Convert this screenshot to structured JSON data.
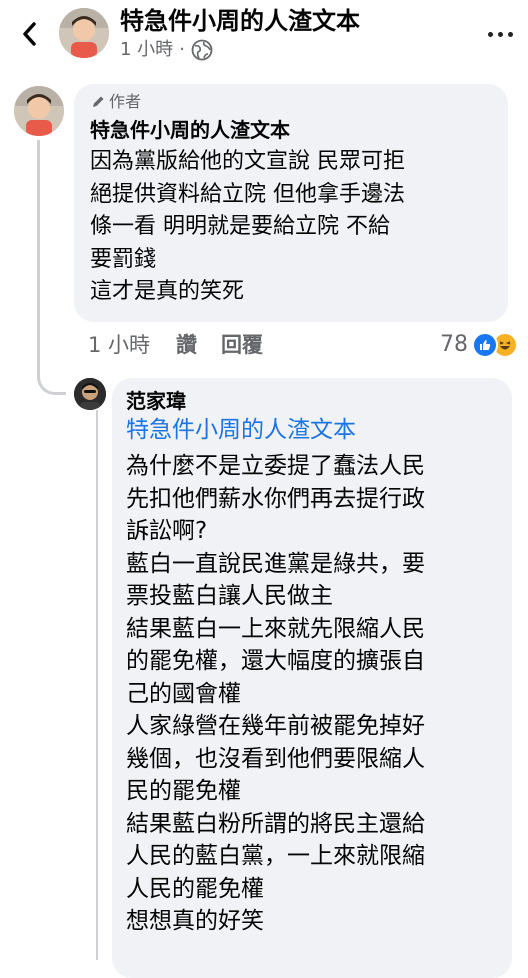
{
  "header": {
    "back_icon": "chevron-left-icon",
    "title": "特急件小周的人渣文本",
    "time": "1 小時",
    "separator": "·",
    "privacy_icon": "globe-icon",
    "more_icon": "more-horizontal-icon"
  },
  "comment1": {
    "badge": "作者",
    "badge_icon": "pencil-icon",
    "author": "特急件小周的人渣文本",
    "lines": [
      "因為黨版給他的文宣說 民眾可拒",
      "絕提供資料給立院 但他拿手邊法",
      "條一看 明明就是要給立院 不給",
      "要罰錢",
      "這才是真的笑死"
    ],
    "time": "1 小時",
    "like_label": "讚",
    "reply_label": "回覆",
    "reaction_count": "78",
    "reactions": [
      "like-icon",
      "haha-icon"
    ]
  },
  "comment2": {
    "author": "范家瑋",
    "mention": "特急件小周的人渣文本",
    "lines": [
      "為什麼不是立委提了蠢法人民",
      "先扣他們薪水你們再去提行政",
      "訴訟啊?",
      "藍白一直說民進黨是綠共，要",
      "票投藍白讓人民做主",
      "結果藍白一上來就先限縮人民",
      "的罷免權，還大幅度的擴張自",
      "己的國會權",
      "人家綠營在幾年前被罷免掉好",
      "幾個，也沒看到他們要限縮人",
      "民的罷免權",
      "結果藍白粉所謂的將民主還給",
      "人民的藍白黨，一上來就限縮",
      "人民的罷免權",
      "想想真的好笑"
    ]
  },
  "colors": {
    "bubble": "#f0f2f5",
    "secondary_text": "#65676b",
    "link": "#1b74e4",
    "like": "#1877f2"
  }
}
